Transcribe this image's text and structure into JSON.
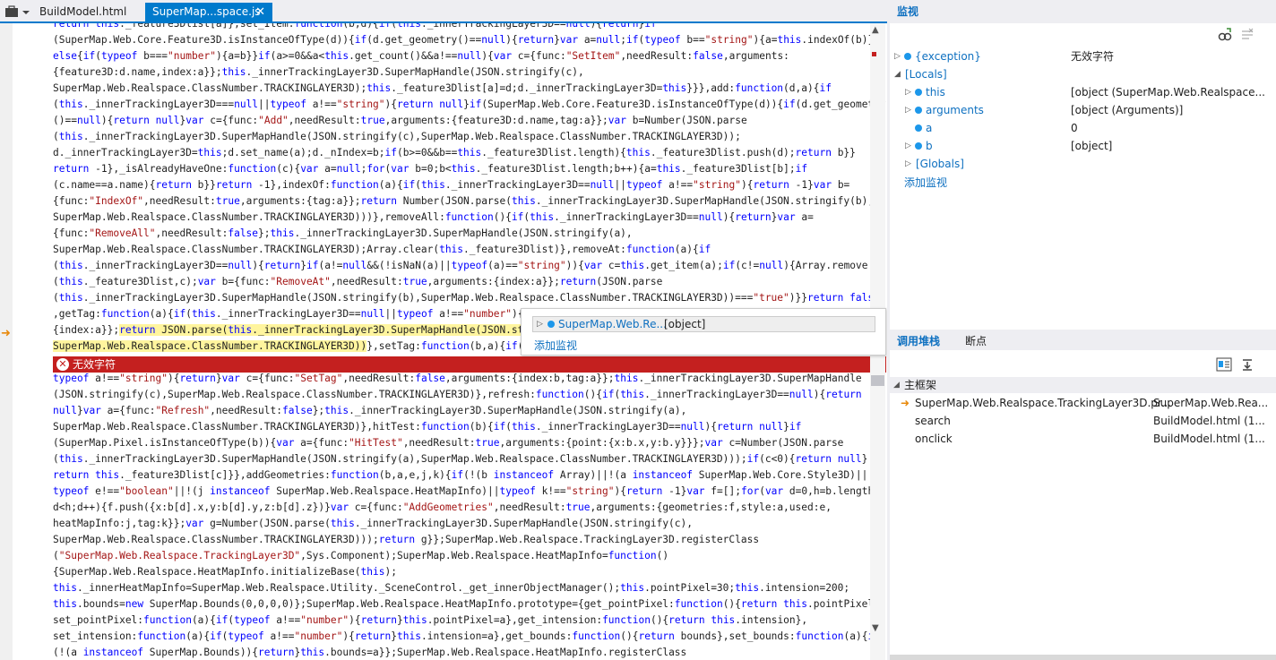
{
  "tabs": [
    {
      "label": "BuildModel.html"
    },
    {
      "label": "SuperMap...space.js",
      "close": "✕"
    }
  ],
  "code_lines_top": [
    "return this._feature3Dlist[a]},set_Item:function(b,d){if(this._innerTrackingLayer3D==null){return}if",
    "(SuperMap.Web.Core.Feature3D.isInstanceOfType(d)){if(d.get_geometry()==null){return}var a=null;if(typeof b==\"string\"){a=this.indexOf(b)}",
    "else{if(typeof b===\"number\"){a=b}}if(a>=0&&a<this.get_count()&&a!==null){var c={func:\"SetItem\",needResult:false,arguments:",
    "{feature3D:d.name,index:a}};this._innerTrackingLayer3D.SuperMapHandle(JSON.stringify(c),",
    "SuperMap.Web.Realspace.ClassNumber.TRACKINGLAYER3D);this._feature3Dlist[a]=d;d._innerTrackingLayer3D=this}}},add:function(d,a){if",
    "(this._innerTrackingLayer3D===null||typeof a!==\"string\"){return null}if(SuperMap.Web.Core.Feature3D.isInstanceOfType(d)){if(d.get_geometry",
    "()==null){return null}var c={func:\"Add\",needResult:true,arguments:{feature3D:d.name,tag:a}};var b=Number(JSON.parse",
    "(this._innerTrackingLayer3D.SuperMapHandle(JSON.stringify(c),SuperMap.Web.Realspace.ClassNumber.TRACKINGLAYER3D));",
    "d._innerTrackingLayer3D=this;d.set_name(a);d._nIndex=b;if(b>=0&&b==this._feature3Dlist.length){this._feature3Dlist.push(d);return b}}",
    "return -1},_isAlreadyHaveOne:function(c){var a=null;for(var b=0;b<this._feature3Dlist.length;b++){a=this._feature3Dlist[b];if",
    "(c.name==a.name){return b}}return -1},indexOf:function(a){if(this._innerTrackingLayer3D==null||typeof a!==\"string\"){return -1}var b=",
    "{func:\"IndexOf\",needResult:true,arguments:{tag:a}};return Number(JSON.parse(this._innerTrackingLayer3D.SuperMapHandle(JSON.stringify(b),",
    "SuperMap.Web.Realspace.ClassNumber.TRACKINGLAYER3D)))},removeAll:function(){if(this._innerTrackingLayer3D==null){return}var a=",
    "{func:\"RemoveAll\",needResult:false};this._innerTrackingLayer3D.SuperMapHandle(JSON.stringify(a),",
    "SuperMap.Web.Realspace.ClassNumber.TRACKINGLAYER3D);Array.clear(this._feature3Dlist)},removeAt:function(a){if",
    "(this._innerTrackingLayer3D==null){return}if(a!=null&&(!isNaN(a)||typeof(a)==\"string\")){var c=this.get_item(a);if(c!=null){Array.remove",
    "(this._feature3Dlist,c);var b={func:\"RemoveAt\",needResult:true,arguments:{index:a}};return(JSON.parse",
    "(this._innerTrackingLayer3D.SuperMapHandle(JSON.stringify(b),SuperMap.Web.Realspace.ClassNumber.TRACKINGLAYER3D))===\"true\")}}return false}",
    ",getTag:function(a){if(this._innerTrackingLayer3D==null||typeof a!==\"number\"){r",
    "{index:a}};return JSON.parse(this._innerTrackingLayer3D.SuperMapHandle(JSON.str",
    "SuperMap.Web.Realspace.ClassNumber.TRACKINGLAYER3D))},setTag:function(b,a){if(t"
  ],
  "error_text": "无效字符",
  "code_lines_bottom": [
    "typeof a!==\"string\"){return}var c={func:\"SetTag\",needResult:false,arguments:{index:b,tag:a}};this._innerTrackingLayer3D.SuperMapHandle",
    "(JSON.stringify(c),SuperMap.Web.Realspace.ClassNumber.TRACKINGLAYER3D)},refresh:function(){if(this._innerTrackingLayer3D==null){return",
    "null}var a={func:\"Refresh\",needResult:false};this._innerTrackingLayer3D.SuperMapHandle(JSON.stringify(a),",
    "SuperMap.Web.Realspace.ClassNumber.TRACKINGLAYER3D)},hitTest:function(b){if(this._innerTrackingLayer3D==null){return null}if",
    "(SuperMap.Pixel.isInstanceOfType(b)){var a={func:\"HitTest\",needResult:true,arguments:{point:{x:b.x,y:b.y}}};var c=Number(JSON.parse",
    "(this._innerTrackingLayer3D.SuperMapHandle(JSON.stringify(a),SuperMap.Web.Realspace.ClassNumber.TRACKINGLAYER3D)));if(c<0){return null}",
    "return this._feature3Dlist[c]}},addGeometries:function(b,a,e,j,k){if(!(b instanceof Array)||!(a instanceof SuperMap.Web.Core.Style3D)||",
    "typeof e!==\"boolean\"||!(j instanceof SuperMap.Web.Realspace.HeatMapInfo)||typeof k!==\"string\"){return -1}var f=[];for(var d=0,h=b.length;",
    "d<h;d++){f.push({x:b[d].x,y:b[d].y,z:b[d].z})}var c={func:\"AddGeometries\",needResult:true,arguments:{geometries:f,style:a,used:e,",
    "heatMapInfo:j,tag:k}};var g=Number(JSON.parse(this._innerTrackingLayer3D.SuperMapHandle(JSON.stringify(c),",
    "SuperMap.Web.Realspace.ClassNumber.TRACKINGLAYER3D)));return g}};SuperMap.Web.Realspace.TrackingLayer3D.registerClass",
    "(\"SuperMap.Web.Realspace.TrackingLayer3D\",Sys.Component);SuperMap.Web.Realspace.HeatMapInfo=function()",
    "{SuperMap.Web.Realspace.HeatMapInfo.initializeBase(this);",
    "this._innerHeatMapInfo=SuperMap.Web.Realspace.Utility._SceneControl._get_innerObjectManager();this.pointPixel=30;this.intension=200;",
    "this.bounds=new SuperMap.Bounds(0,0,0,0)};SuperMap.Web.Realspace.HeatMapInfo.prototype={get_pointPixel:function(){return this.pointPixel},",
    "set_pointPixel:function(a){if(typeof a!==\"number\"){return}this.pointPixel=a},get_intension:function(){return this.intension},",
    "set_intension:function(a){if(typeof a!==\"number\"){return}this.intension=a},get_bounds:function(){return bounds},set_bounds:function(a){if",
    "(!(a instanceof SuperMap.Bounds)){return}this.bounds=a}};SuperMap.Web.Realspace.HeatMapInfo.registerClass"
  ],
  "tooltip": {
    "name": "SuperMap.Web.Re...",
    "value": "[object]",
    "add_watch": "添加监视"
  },
  "watch": {
    "title": "监视",
    "rows": [
      {
        "name": "{exception}",
        "value": "无效字符"
      },
      {
        "name": "[Locals]",
        "value": ""
      },
      {
        "name": "this",
        "value": "[object (SuperMap.Web.Realspace..."
      },
      {
        "name": "arguments",
        "value": "[object (Arguments)]"
      },
      {
        "name": "a",
        "value": "0"
      },
      {
        "name": "b",
        "value": "[object]"
      },
      {
        "name": "[Globals]",
        "value": ""
      }
    ],
    "add_watch": "添加监视"
  },
  "callstack": {
    "tabs": [
      "调用堆栈",
      "断点"
    ],
    "header": "主框架",
    "rows": [
      {
        "name": "SuperMap.Web.Realspace.TrackingLayer3D.pr...",
        "location": "SuperMap.Web.Rea..."
      },
      {
        "name": "search",
        "location": "BuildModel.html (1..."
      },
      {
        "name": "onclick",
        "location": "BuildModel.html (1..."
      }
    ]
  },
  "colors": {
    "accent": "#007acc",
    "error": "#c4201f",
    "keyword": "#0000ff",
    "string": "#a31515",
    "highlight": "#fff59e"
  }
}
